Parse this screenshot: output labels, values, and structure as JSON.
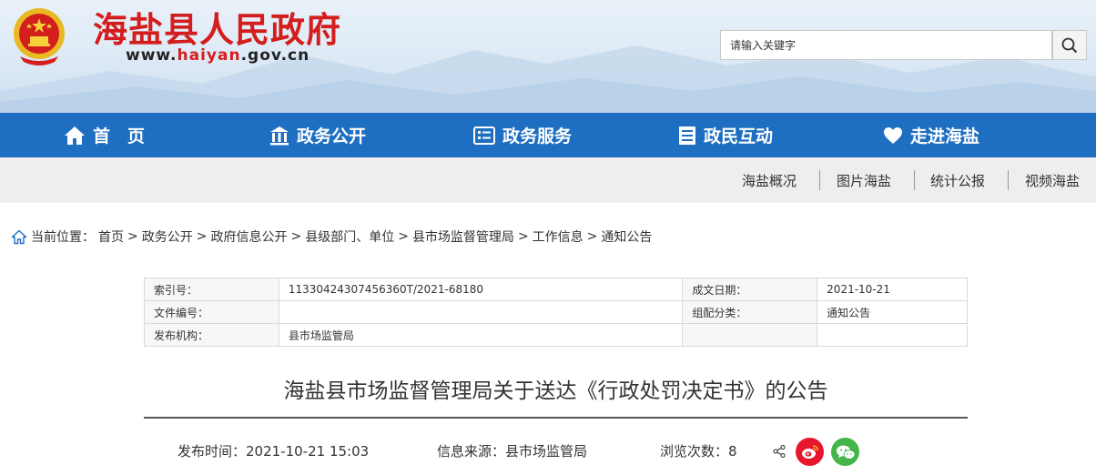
{
  "header": {
    "site_title": "海盐县人民政府",
    "url_prefix": "www.",
    "url_highlight": "haiyan",
    "url_suffix": ".gov.cn",
    "search_placeholder": "请输入关键字"
  },
  "nav": {
    "items": [
      {
        "label": "首　页",
        "icon": "home-icon"
      },
      {
        "label": "政务公开",
        "icon": "government-building-icon"
      },
      {
        "label": "政务服务",
        "icon": "service-list-icon"
      },
      {
        "label": "政民互动",
        "icon": "document-list-icon"
      },
      {
        "label": "走进海盐",
        "icon": "heart-icon"
      }
    ]
  },
  "subnav": {
    "items": [
      "海盐概况",
      "图片海盐",
      "统计公报",
      "视频海盐"
    ]
  },
  "breadcrumb": {
    "label": "当前位置：",
    "items": [
      "首页",
      "政务公开",
      "政府信息公开",
      "县级部门、单位",
      "县市场监督管理局",
      "工作信息",
      "通知公告"
    ],
    "separator": ">"
  },
  "info": {
    "index_label": "索引号：",
    "index_value": "11330424307456360T/2021-68180",
    "date_label": "成文日期：",
    "date_value": "2021-10-21",
    "doc_no_label": "文件编号：",
    "doc_no_value": "",
    "category_label": "组配分类：",
    "category_value": "通知公告",
    "publisher_label": "发布机构：",
    "publisher_value": "县市场监管局"
  },
  "article": {
    "title": "海盐县市场监督管理局关于送达《行政处罚决定书》的公告",
    "publish_time": "发布时间：2021-10-21 15:03",
    "source": "信息来源：县市场监管局",
    "views": "浏览次数：8"
  },
  "colors": {
    "brand_red": "#d41e1e",
    "nav_blue": "#1e6fc2",
    "weibo_red": "#e6162d",
    "wechat_green": "#44b549"
  }
}
